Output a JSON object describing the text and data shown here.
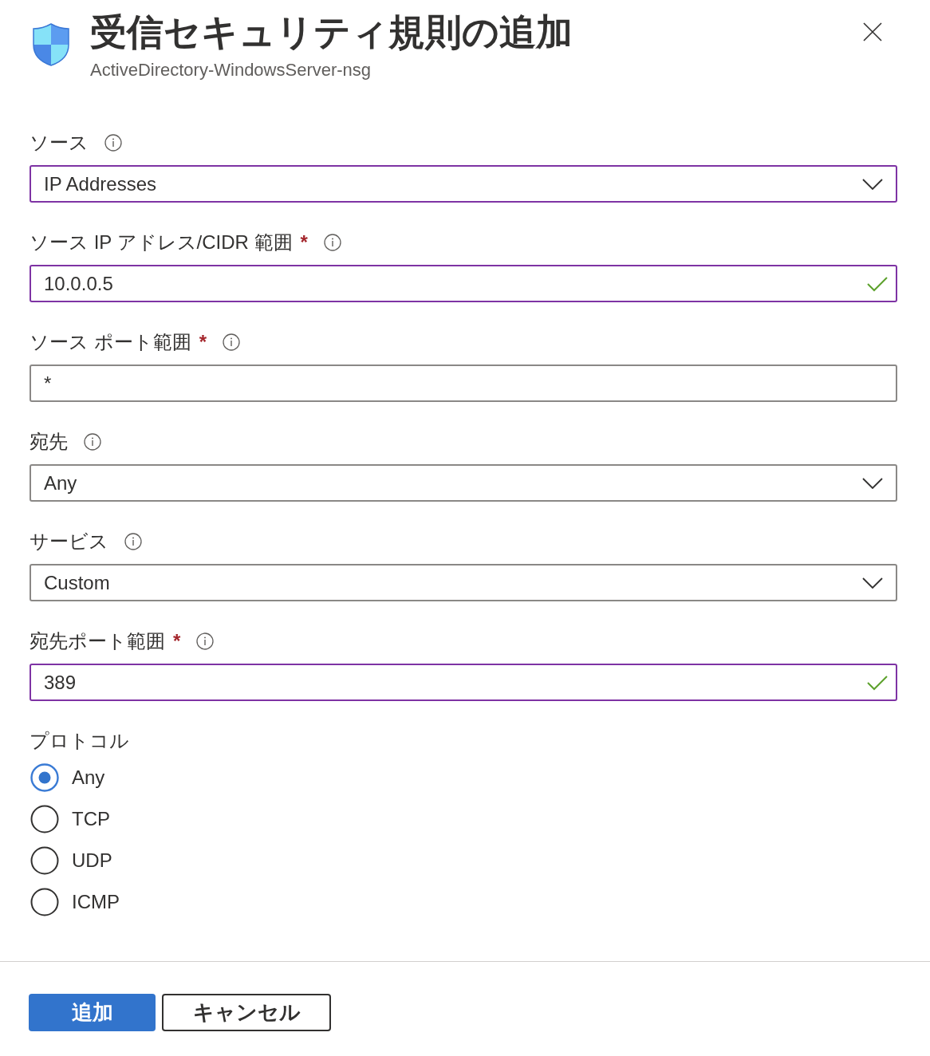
{
  "header": {
    "title": "受信セキュリティ規則の追加",
    "subtitle": "ActiveDirectory-WindowsServer-nsg"
  },
  "fields": [
    {
      "kind": "dropdown",
      "label": "ソース",
      "info": true,
      "value": "IP Addresses",
      "modified": true,
      "valid": false
    },
    {
      "kind": "text",
      "label": "ソース IP アドレス/CIDR 範囲",
      "required_mark": "*",
      "info": true,
      "value": "10.0.0.5",
      "modified": true,
      "valid": true
    },
    {
      "kind": "text",
      "label": "ソース ポート範囲",
      "required_mark": "*",
      "info": true,
      "value": "*",
      "modified": false,
      "valid": false
    },
    {
      "kind": "dropdown",
      "label": "宛先",
      "info": true,
      "value": "Any",
      "modified": false,
      "valid": false
    },
    {
      "kind": "dropdown",
      "label": "サービス",
      "info": true,
      "value": "Custom",
      "modified": false,
      "valid": false
    },
    {
      "kind": "text",
      "label": "宛先ポート範囲",
      "required_mark": "*",
      "info": true,
      "value": "389",
      "modified": true,
      "valid": true
    }
  ],
  "protocol": {
    "label": "プロトコル",
    "info": false,
    "options": [
      {
        "label": "Any",
        "selected": true
      },
      {
        "label": "TCP",
        "selected": false
      },
      {
        "label": "UDP",
        "selected": false
      },
      {
        "label": "ICMP",
        "selected": false
      }
    ]
  },
  "buttons": [
    {
      "kind": "primary",
      "label": "追加"
    },
    {
      "kind": "secondary",
      "label": "キャンセル"
    }
  ]
}
